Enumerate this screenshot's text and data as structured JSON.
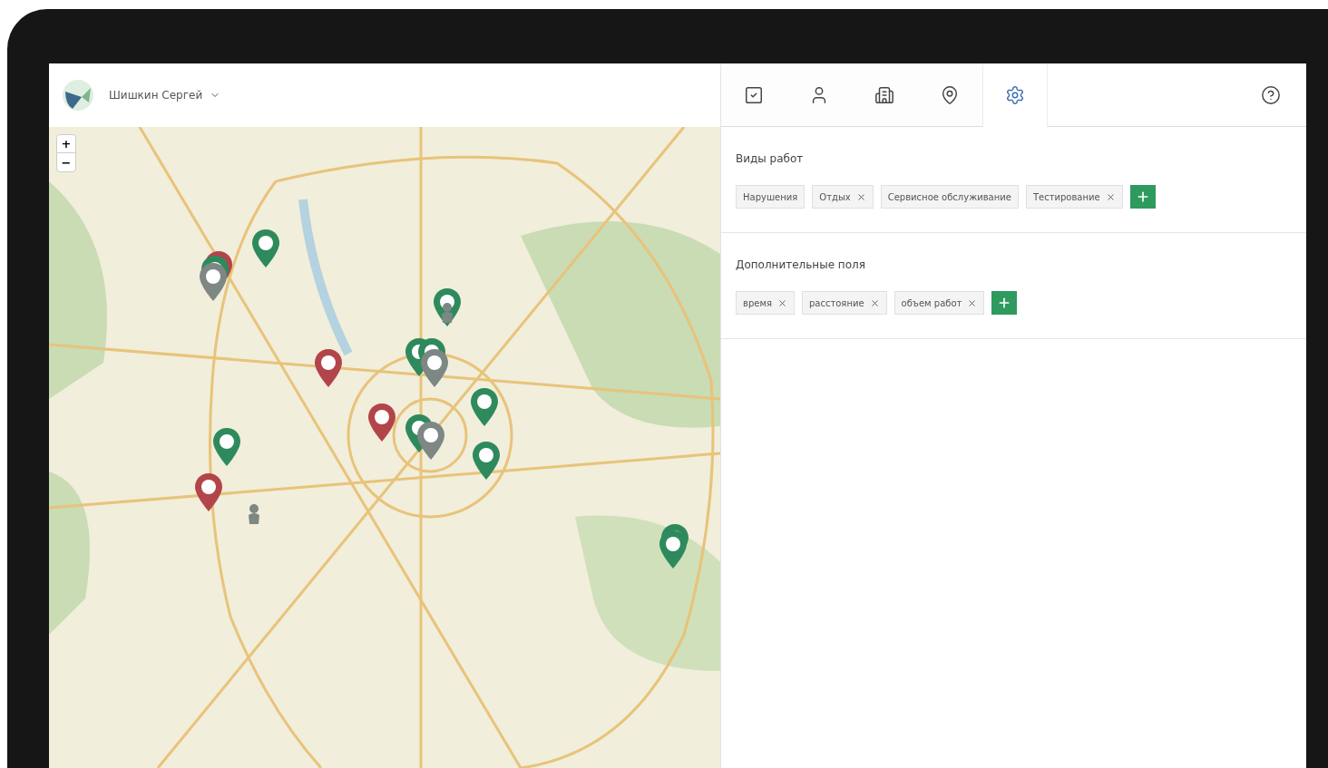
{
  "header": {
    "user_name": "Шишкин Сергей"
  },
  "map": {
    "zoom_in": "+",
    "zoom_out": "−",
    "markers": [
      {
        "kind": "pin",
        "color": "#2e8a5c"
      },
      {
        "kind": "cluster",
        "pins": [
          {
            "color": "#b2454a"
          },
          {
            "color": "#2e8a5c"
          },
          {
            "color": "#7d8784"
          }
        ]
      },
      {
        "kind": "pin",
        "color": "#2e8a5c"
      },
      {
        "kind": "person",
        "color": "#7d8784"
      },
      {
        "kind": "pin",
        "color": "#b2454a"
      },
      {
        "kind": "cluster",
        "pins": [
          {
            "color": "#2e8a5c"
          },
          {
            "color": "#2e8a5c"
          },
          {
            "color": "#7d8784"
          }
        ]
      },
      {
        "kind": "pin",
        "color": "#b2454a"
      },
      {
        "kind": "cluster",
        "pins": [
          {
            "color": "#2e8a5c"
          },
          {
            "color": "#7d8784"
          }
        ]
      },
      {
        "kind": "pin",
        "color": "#2e8a5c"
      },
      {
        "kind": "pin",
        "color": "#2e8a5c"
      },
      {
        "kind": "pin",
        "color": "#2e8a5c"
      },
      {
        "kind": "pin",
        "color": "#b2454a"
      },
      {
        "kind": "person",
        "color": "#7d8784"
      },
      {
        "kind": "cluster",
        "pins": [
          {
            "color": "#2e8a5c"
          },
          {
            "color": "#2e8a5c"
          }
        ]
      }
    ]
  },
  "tabs": [
    {
      "kind": "tasks",
      "selected": false
    },
    {
      "kind": "user",
      "selected": false
    },
    {
      "kind": "building",
      "selected": false
    },
    {
      "kind": "location",
      "selected": false
    },
    {
      "kind": "settings",
      "selected": true
    }
  ],
  "sections": [
    {
      "title": "Виды работ",
      "tags": [
        {
          "label": "Нарушения",
          "removable": false
        },
        {
          "label": "Отдых",
          "removable": true
        },
        {
          "label": "Сервисное обслуживание",
          "removable": false
        },
        {
          "label": "Тестирование",
          "removable": true
        }
      ]
    },
    {
      "title": "Дополнительные поля",
      "tags": [
        {
          "label": "время",
          "removable": true
        },
        {
          "label": "расстояние",
          "removable": true
        },
        {
          "label": "объем работ",
          "removable": true
        }
      ]
    }
  ]
}
